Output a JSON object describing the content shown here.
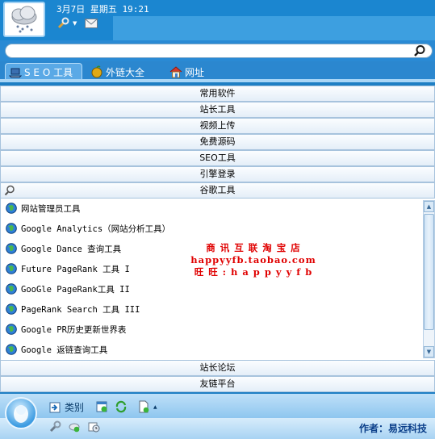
{
  "header": {
    "datetime": "3月7日 星期五 19:21"
  },
  "search": {
    "value": "",
    "placeholder": ""
  },
  "tabs": [
    {
      "label": "S E O 工具",
      "active": true
    },
    {
      "label": "外链大全",
      "active": false
    },
    {
      "label": "网址",
      "active": false
    }
  ],
  "categories_top": [
    "常用软件",
    "站长工具",
    "视频上传",
    "免费源码",
    "SEO工具",
    "引擎登录",
    "谷歌工具"
  ],
  "items": [
    "网站管理员工具",
    "Google Analytics（网站分析工具）",
    "Google Dance 查询工具",
    "Future PageRank 工具 I",
    "GooGle PageRank工具 II",
    "PageRank Search 工具 III",
    "Google PR历史更新世界表",
    "Google 返链查询工具"
  ],
  "promo": {
    "line1": "商 讯 互 联 淘 宝 店",
    "line2": "happyyfb.taobao.com",
    "line3": "旺 旺 : h a p p y y f b"
  },
  "categories_bottom": [
    "站长论坛",
    "友链平台"
  ],
  "footer": {
    "category_label": "类别",
    "author": "作者：易远科技"
  },
  "colors": {
    "header_bg": "#1b86d0",
    "promo_text": "#e00000",
    "author_text": "#0b3f8a"
  }
}
